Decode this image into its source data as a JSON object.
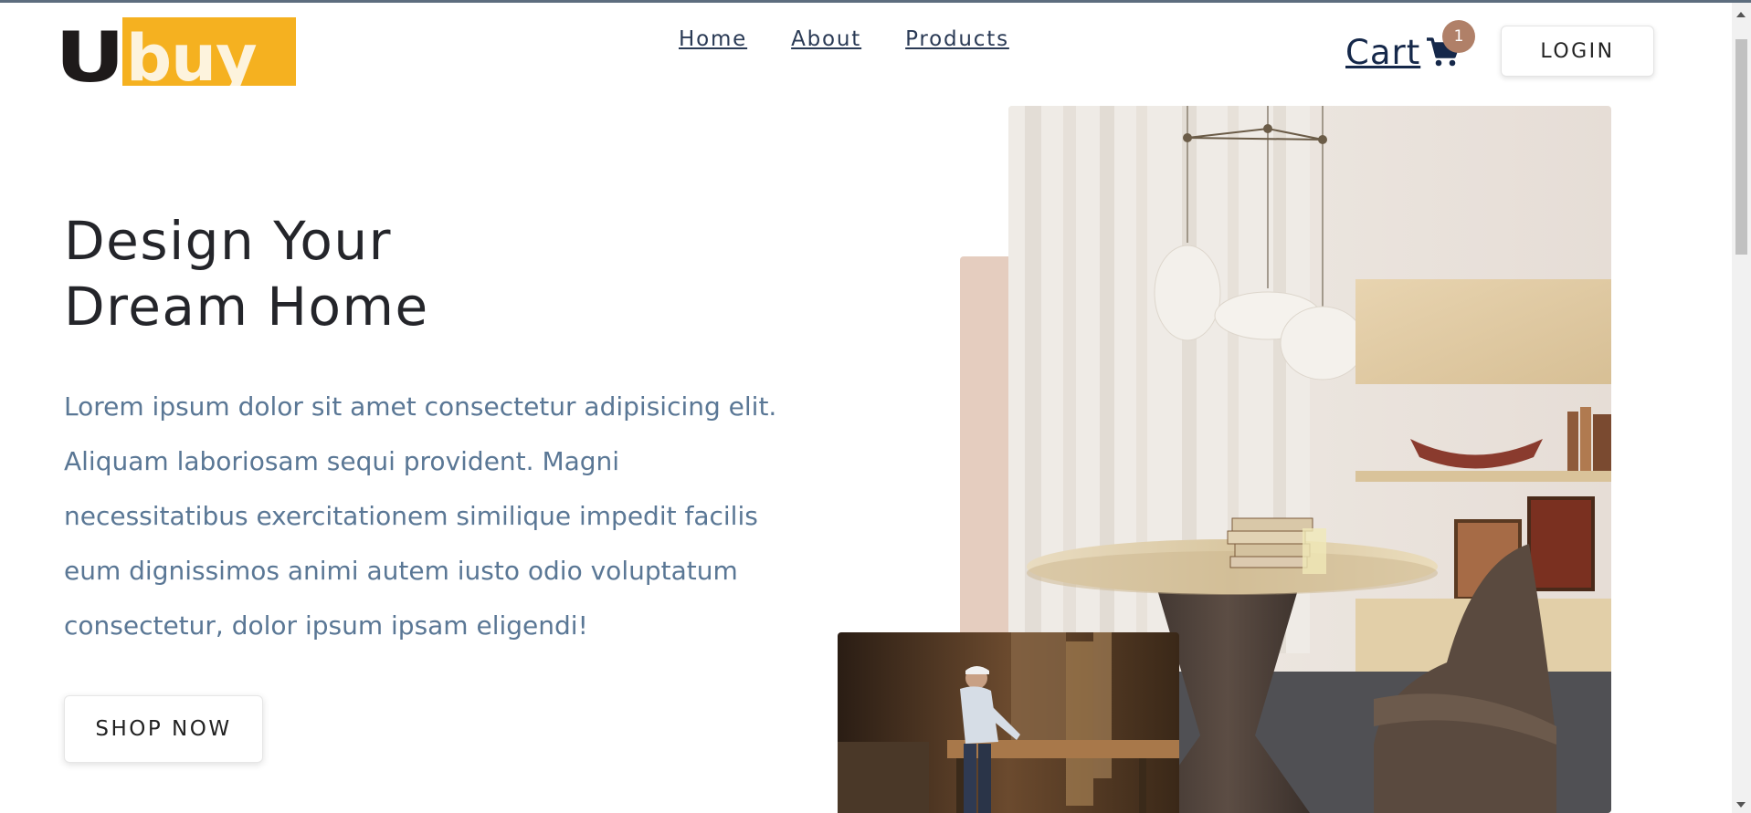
{
  "brand": {
    "logo_text": "Ubuy",
    "logo_part_dark": "U",
    "logo_part_light": "buy",
    "colors": {
      "orange": "#f5b120",
      "dark": "#1e1a1a"
    }
  },
  "nav": {
    "items": [
      {
        "label": "Home"
      },
      {
        "label": "About"
      },
      {
        "label": "Products"
      }
    ]
  },
  "cart": {
    "label": "Cart",
    "count": "1",
    "icon": "shopping-cart-icon"
  },
  "login": {
    "label": "LOGIN"
  },
  "hero": {
    "title_line1": "Design Your",
    "title_line2": "Dream Home",
    "text": "Lorem ipsum dolor sit amet consectetur adipisicing elit. Aliquam laboriosam sequi provident. Magni necessitatibus exercitationem similique impedit facilis eum dignissimos animi autem iusto odio voluptatum consectetur, dolor ipsum ipsam eligendi!",
    "cta": "SHOP NOW"
  },
  "colors": {
    "accent_pink": "#e5cdbf",
    "badge": "#b08068",
    "text_muted": "#5a7795",
    "nav_text": "#2a3a55"
  }
}
